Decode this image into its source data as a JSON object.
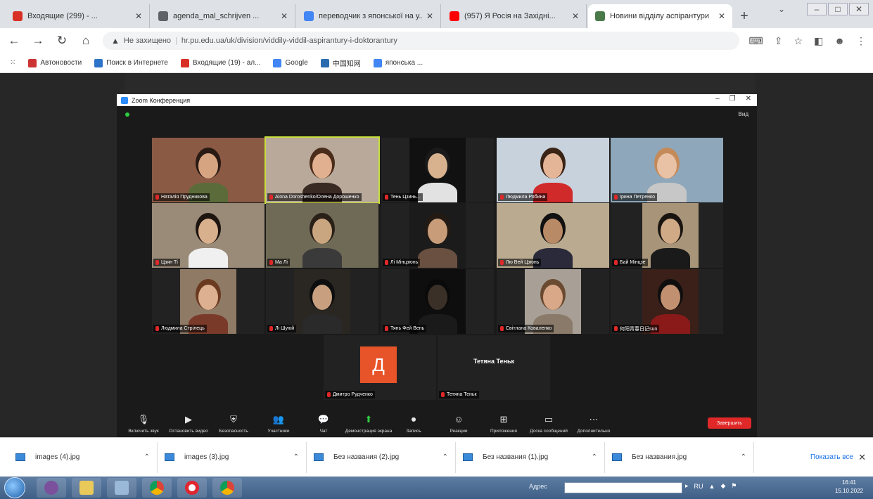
{
  "browser": {
    "tabs": [
      {
        "title": "Входящие (299) - ...",
        "icon_color": "#d93025",
        "active": false
      },
      {
        "title": "agenda_mal_schrijven ...",
        "icon_color": "#5f6368",
        "active": false
      },
      {
        "title": "переводчик з японської на у...",
        "icon_color": "#4285f4",
        "active": false
      },
      {
        "title": "(957) Я Росія на Західні...",
        "icon_color": "#ff0000",
        "active": false
      },
      {
        "title": "Новини відділу аспірантури",
        "icon_color": "#4a7a4a",
        "active": true
      }
    ],
    "new_tab_label": "+",
    "address": {
      "security_label": "Не захищено",
      "url": "hr.pu.edu.ua/uk/division/viddily-viddil-aspirantury-i-doktorantury"
    },
    "bookmarks": [
      {
        "label": "Автоновости",
        "color": "#cc3333"
      },
      {
        "label": "Поиск в Интернете",
        "color": "#2d73c8"
      },
      {
        "label": "Входящие (19) - ал...",
        "color": "#d93025"
      },
      {
        "label": "Google",
        "color": "#4285f4"
      },
      {
        "label": "中国知网",
        "color": "#2a6bb0"
      },
      {
        "label": "японська ...",
        "color": "#4285f4"
      }
    ]
  },
  "zoom": {
    "window_title": "Zoom Конференция",
    "view_label": "Вид",
    "participants": [
      {
        "name": "Наталія Прудникова",
        "bg": "#8a5a44",
        "skin": "#d7a482",
        "hair": "#2a1a14",
        "shirt": "#5c6b3a"
      },
      {
        "name": "Alona Doroshenko/Олена Дорошенко",
        "bg": "#b8a99a",
        "skin": "#e0b090",
        "hair": "#4a2c1a",
        "shirt": "#3a2a24",
        "speaking": true
      },
      {
        "name": "Тень Цзинь...",
        "bg": "#111111",
        "skin": "#d8b28e",
        "hair": "#1a1a1a",
        "shirt": "#e2e2e2"
      },
      {
        "name": "Людмила Рябина",
        "bg": "#c8d2dc",
        "skin": "#e5b598",
        "hair": "#3a2416",
        "shirt": "#d12a2a"
      },
      {
        "name": "Ірина Петренко",
        "bg": "#8ea7ba",
        "skin": "#e9c1a4",
        "hair": "#c48a5a",
        "shirt": "#c7c7c7"
      },
      {
        "name": "Цзян Ті",
        "bg": "#9a8a78",
        "skin": "#d9b08e",
        "hair": "#1e1410",
        "shirt": "#f0f0f0"
      },
      {
        "name": "Ма Лі",
        "bg": "#6e6a56",
        "skin": "#c9a680",
        "hair": "#2a2018",
        "shirt": "#3a3a3a"
      },
      {
        "name": "Лі Мінцзюнь",
        "bg": "#1b1b1b",
        "skin": "#c89c78",
        "hair": "#231a14",
        "shirt": "#6a5040"
      },
      {
        "name": "Лю Вей Цзюнь",
        "bg": "#b9aa90",
        "skin": "#b98a66",
        "hair": "#111111",
        "shirt": "#2a2a3a"
      },
      {
        "name": "Бай Мінцзе",
        "bg": "#a89478",
        "skin": "#d0aa86",
        "hair": "#1a1410",
        "shirt": "#1a1a1a"
      },
      {
        "name": "Людмила Стрілець",
        "bg": "#8f7a66",
        "skin": "#dcb090",
        "hair": "#6a3a20",
        "shirt": "#7a3a2a"
      },
      {
        "name": "Лі Шуюй",
        "bg": "#2a2622",
        "skin": "#c8a080",
        "hair": "#0e0e0e",
        "shirt": "#2a2a2a"
      },
      {
        "name": "Тянь Фей Вень",
        "bg": "#0e0e0e",
        "skin": "#3a3028",
        "hair": "#0a0a0a",
        "shirt": "#1a1a1a"
      },
      {
        "name": "Світлана Коваленко",
        "bg": "#a8a096",
        "skin": "#d9a888",
        "hair": "#6a4a30",
        "shirt": "#8a7a6a"
      },
      {
        "name": "何阳青春日记sun",
        "bg": "#3a2018",
        "skin": "#c09070",
        "hair": "#0e0e0e",
        "shirt": "#8a1a1a"
      }
    ],
    "bottom_participants": [
      {
        "name": "Дмитро Рудченко",
        "avatar_letter": "Д",
        "avatar_color": "#e8542a"
      },
      {
        "name": "Тетяна Теньк",
        "display_name": "Тетяна Теньк"
      }
    ],
    "toolbar": [
      {
        "label": "Включить звук",
        "icon": "microphone-icon"
      },
      {
        "label": "Остановить видео",
        "icon": "video-camera-icon"
      },
      {
        "label": "Безопасность",
        "icon": "shield-icon"
      },
      {
        "label": "Участники",
        "icon": "participants-icon"
      },
      {
        "label": "Чат",
        "icon": "chat-icon"
      },
      {
        "label": "Демонстрация экрана",
        "icon": "share-screen-icon",
        "green": true
      },
      {
        "label": "Запись",
        "icon": "record-icon"
      },
      {
        "label": "Реакции",
        "icon": "reactions-icon"
      },
      {
        "label": "Приложения",
        "icon": "apps-icon"
      },
      {
        "label": "Доска сообщений",
        "icon": "whiteboard-icon"
      },
      {
        "label": "Дополнительно",
        "icon": "more-icon"
      }
    ],
    "end_label": "Завершить"
  },
  "downloads": {
    "items": [
      "images (4).jpg",
      "images (3).jpg",
      "Без названия (2).jpg",
      "Без названия (1).jpg",
      "Без названия.jpg"
    ],
    "show_all_label": "Показать все"
  },
  "taskbar": {
    "address_label": "Адрес",
    "lang": "RU",
    "clock_time": "16:41",
    "clock_date": "15.10.2022"
  }
}
